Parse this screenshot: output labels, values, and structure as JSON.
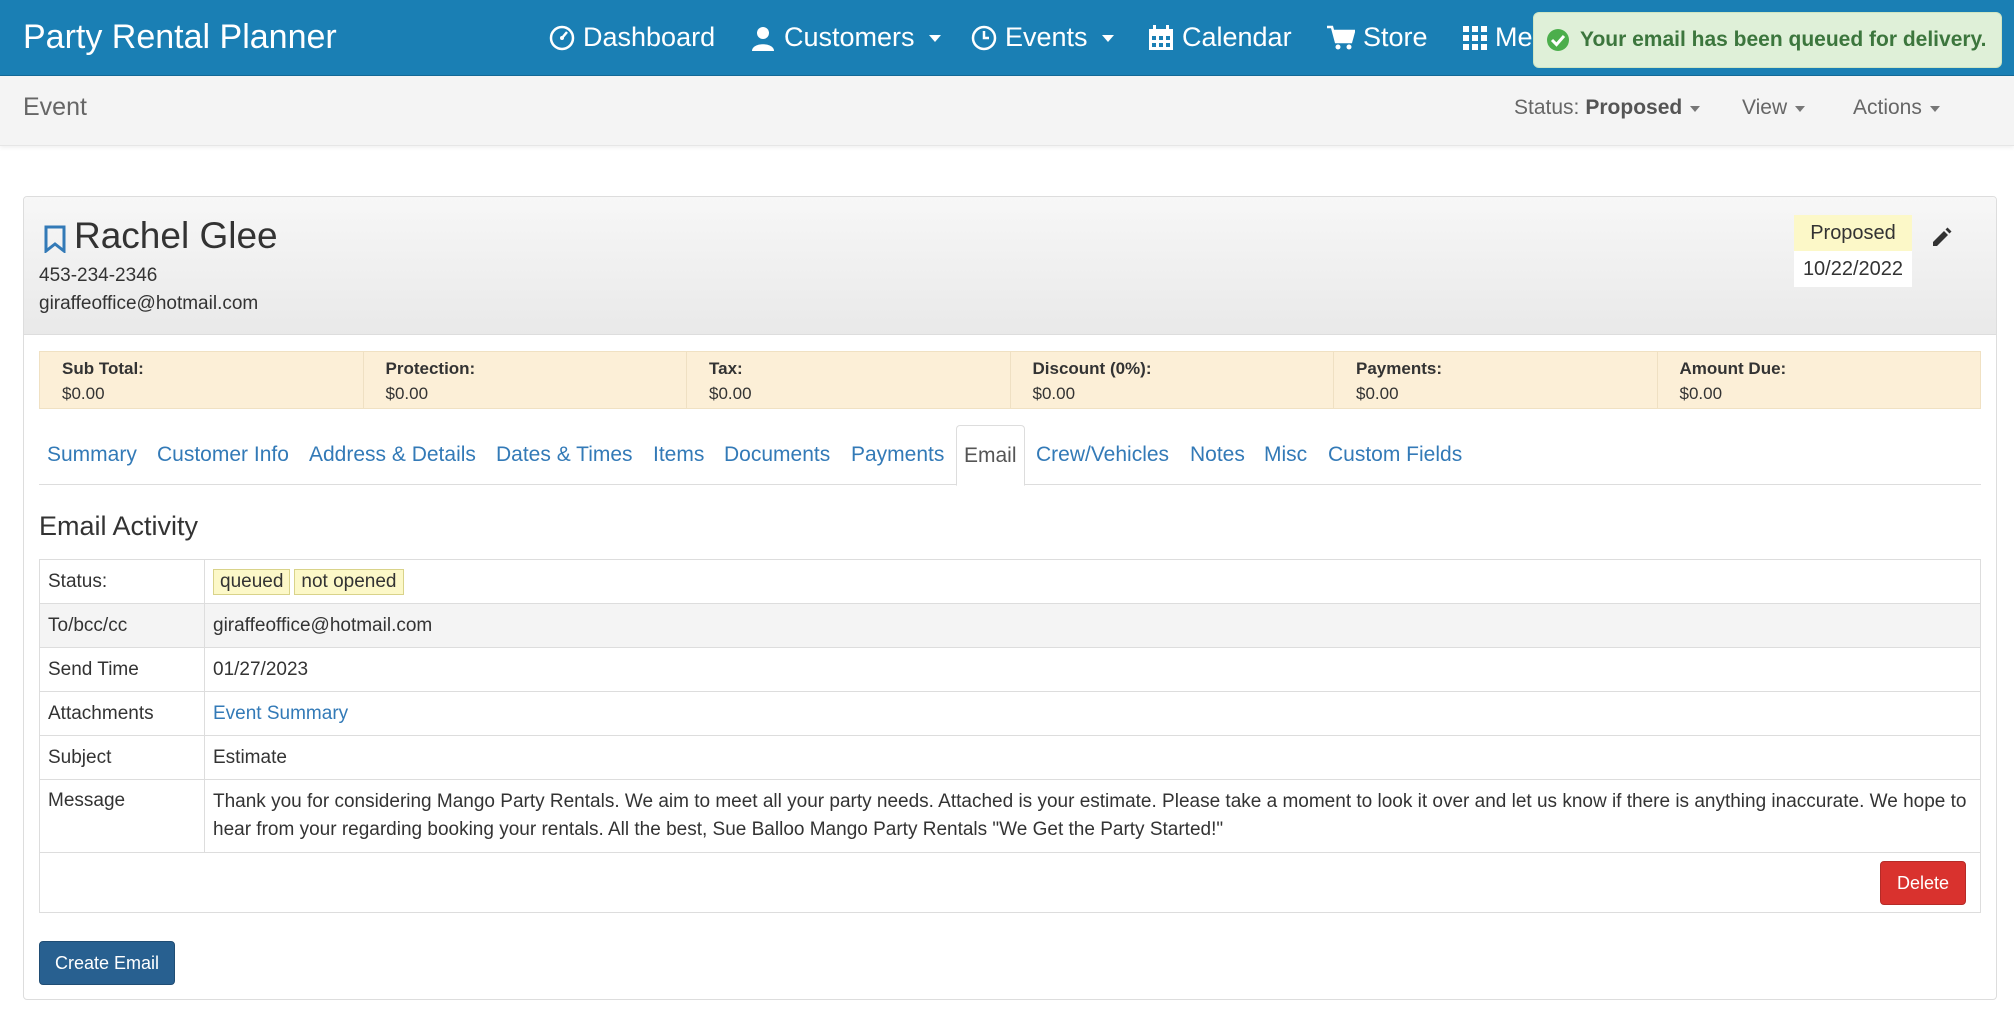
{
  "navbar": {
    "brand": "Party Rental Planner",
    "items": [
      {
        "label": "Dashboard",
        "icon": "dashboard-icon"
      },
      {
        "label": "Customers",
        "icon": "user-icon"
      },
      {
        "label": "Events",
        "icon": "clock-icon"
      },
      {
        "label": "Calendar",
        "icon": "calendar-icon"
      },
      {
        "label": "Store",
        "icon": "cart-icon"
      },
      {
        "label": "Me",
        "icon": "grid-icon"
      }
    ],
    "toast": "Your email has been queued for delivery."
  },
  "subbar": {
    "title": "Event",
    "status_prefix": "Status:",
    "status_value": "Proposed",
    "view_label": "View",
    "actions_label": "Actions"
  },
  "customer": {
    "name": "Rachel Glee",
    "phone": "453-234-2346",
    "email": "giraffeoffice@hotmail.com",
    "status": "Proposed",
    "date": "10/22/2022"
  },
  "totals": [
    {
      "label": "Sub Total:",
      "value": "$0.00"
    },
    {
      "label": "Protection:",
      "value": "$0.00"
    },
    {
      "label": "Tax:",
      "value": "$0.00"
    },
    {
      "label": "Discount (0%):",
      "value": "$0.00"
    },
    {
      "label": "Payments:",
      "value": "$0.00"
    },
    {
      "label": "Amount Due:",
      "value": "$0.00"
    }
  ],
  "tabs": [
    "Summary",
    "Customer Info",
    "Address & Details",
    "Dates & Times",
    "Items",
    "Documents",
    "Payments",
    "Email",
    "Crew/Vehicles",
    "Notes",
    "Misc",
    "Custom Fields"
  ],
  "active_tab": "Email",
  "email_activity": {
    "title": "Email Activity",
    "rows": {
      "status_label": "Status:",
      "status_badges": [
        "queued",
        "not opened"
      ],
      "to_label": "To/bcc/cc",
      "to_value": "giraffeoffice@hotmail.com",
      "send_label": "Send Time",
      "send_value": "01/27/2023",
      "attach_label": "Attachments",
      "attach_value": "Event Summary",
      "subject_label": "Subject",
      "subject_value": "Estimate",
      "message_label": "Message",
      "message_value": "Thank you for considering Mango Party Rentals. We aim to meet all your party needs. Attached is your estimate. Please take a moment to look it over and let us know if there is anything inaccurate. We hope to hear from your regarding booking your rentals. All the best, Sue Balloo Mango Party Rentals \"We Get the Party Started!\""
    },
    "delete_label": "Delete",
    "create_label": "Create Email"
  },
  "colors": {
    "navbar": "#1a7fb4",
    "toast_bg": "#dff0d8",
    "toast_text": "#3c763d",
    "link": "#337ab7",
    "delete": "#d9322e",
    "create": "#286090",
    "totals_bg": "#fcefd7",
    "badge_bg": "#fcf8c8"
  }
}
